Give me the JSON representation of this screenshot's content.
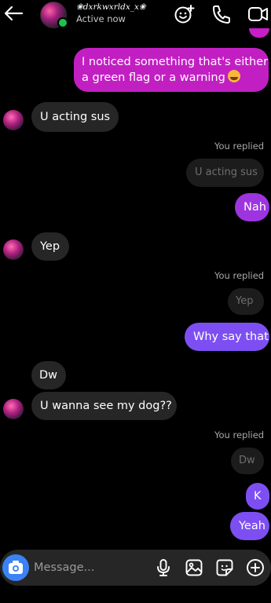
{
  "header": {
    "username": "❀dxrkwxrldx_x❀",
    "status": "Active now",
    "colors": {
      "online": "#1bc34a"
    }
  },
  "messages": [
    {
      "id": "m1",
      "side": "out",
      "text": "I noticed something that's either",
      "text2": "a green flag or a warning",
      "emoji": "smiling-face-with-hearts"
    },
    {
      "id": "m2",
      "side": "in",
      "text": "U acting sus"
    },
    {
      "id": "m3",
      "side": "out",
      "replied_label": "You replied",
      "quote": "U acting sus",
      "text": "Nah"
    },
    {
      "id": "m4",
      "side": "in",
      "text": "Yep"
    },
    {
      "id": "m5",
      "side": "out",
      "replied_label": "You replied",
      "quote": "Yep",
      "text": "Why say that"
    },
    {
      "id": "m6",
      "side": "in",
      "text": "Dw"
    },
    {
      "id": "m7",
      "side": "in",
      "text": "U wanna see my dog??"
    },
    {
      "id": "m8",
      "side": "out",
      "replied_label": "You replied",
      "quote": "Dw",
      "text": "K"
    },
    {
      "id": "m9",
      "side": "out",
      "text": "Yeah"
    }
  ],
  "composer": {
    "placeholder": "Message...",
    "icons": [
      "camera-icon",
      "microphone-icon",
      "gallery-icon",
      "sticker-icon",
      "plus-icon"
    ]
  },
  "colors": {
    "pink": "#c21fc3",
    "violet": "#7d4ff2",
    "purple": "#9d34df",
    "incoming": "#262626",
    "camera": "#3b82f6"
  }
}
